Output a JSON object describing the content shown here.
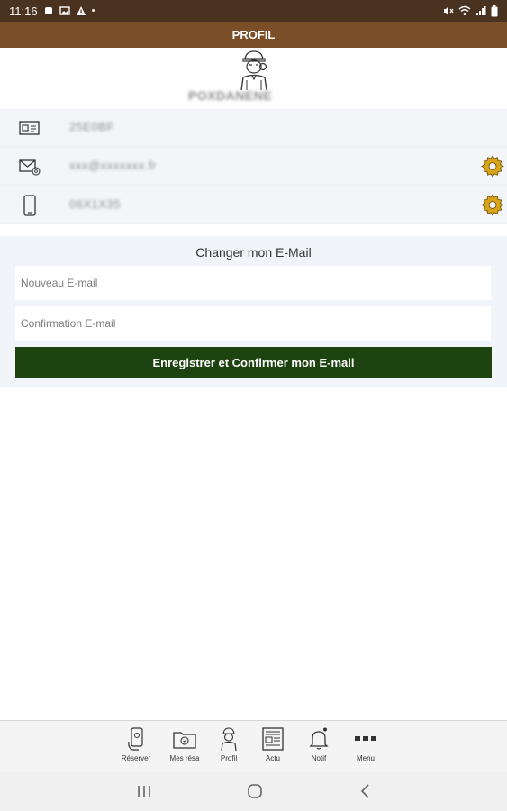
{
  "status_bar": {
    "time": "11:16",
    "dot": "•"
  },
  "header": {
    "title": "PROFIL"
  },
  "profile": {
    "name_blurred": "POXDANENE",
    "rows": [
      {
        "icon": "id-card-icon",
        "value_blurred": "25E0BF",
        "editable": false
      },
      {
        "icon": "email-icon",
        "value_blurred": "xxx@xxxxxxx.fr",
        "editable": true
      },
      {
        "icon": "phone-icon",
        "value_blurred": "06X1X35",
        "editable": true
      }
    ]
  },
  "email_change": {
    "title": "Changer mon E-Mail",
    "new_email_placeholder": "Nouveau E-mail",
    "confirm_email_placeholder": "Confirmation E-mail",
    "save_button": "Enregistrer et Confirmer mon E-mail"
  },
  "bottom_nav": {
    "items": [
      {
        "label": "Réserver",
        "icon": "phone-reserve-icon"
      },
      {
        "label": "Mes résa",
        "icon": "folder-icon"
      },
      {
        "label": "Profil",
        "icon": "person-icon"
      },
      {
        "label": "Actu",
        "icon": "newspaper-icon"
      },
      {
        "label": "Notif",
        "icon": "bell-icon"
      },
      {
        "label": "Menu",
        "icon": "more-icon"
      }
    ]
  },
  "colors": {
    "status_bar": "#4a3220",
    "header": "#7a4f27",
    "button": "#1d4311",
    "gear": "#d9a31a"
  }
}
